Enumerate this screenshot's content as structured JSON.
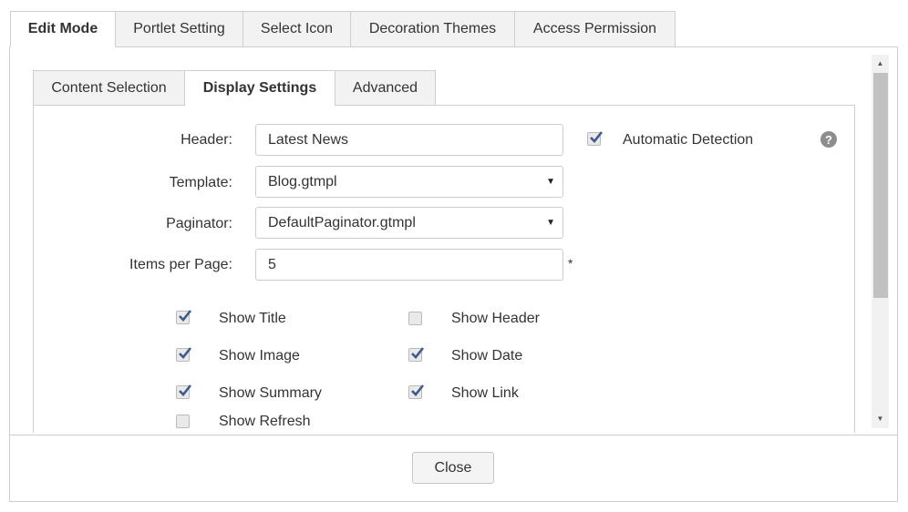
{
  "main_tabs": [
    {
      "label": "Edit Mode",
      "active": true
    },
    {
      "label": "Portlet Setting",
      "active": false
    },
    {
      "label": "Select Icon",
      "active": false
    },
    {
      "label": "Decoration Themes",
      "active": false
    },
    {
      "label": "Access Permission",
      "active": false
    }
  ],
  "sub_tabs": [
    {
      "label": "Content Selection",
      "active": false
    },
    {
      "label": "Display Settings",
      "active": true
    },
    {
      "label": "Advanced",
      "active": false
    }
  ],
  "form": {
    "header_label": "Header:",
    "header_value": "Latest News",
    "automatic_detection_label": "Automatic Detection",
    "automatic_detection_checked": true,
    "template_label": "Template:",
    "template_value": "Blog.gtmpl",
    "paginator_label": "Paginator:",
    "paginator_value": "DefaultPaginator.gtmpl",
    "items_per_page_label": "Items per Page:",
    "items_per_page_value": "5",
    "required_mark": "*",
    "help_icon_glyph": "?"
  },
  "options": [
    {
      "label": "Show Title",
      "checked": true
    },
    {
      "label": "Show Header",
      "checked": false
    },
    {
      "label": "Show Image",
      "checked": true
    },
    {
      "label": "Show Date",
      "checked": true
    },
    {
      "label": "Show Summary",
      "checked": true
    },
    {
      "label": "Show Link",
      "checked": true
    },
    {
      "label": "Show Refresh",
      "checked": false
    }
  ],
  "footer": {
    "close_label": "Close"
  },
  "colors": {
    "check": "#3d5a8a",
    "border": "#cfcfcf"
  }
}
